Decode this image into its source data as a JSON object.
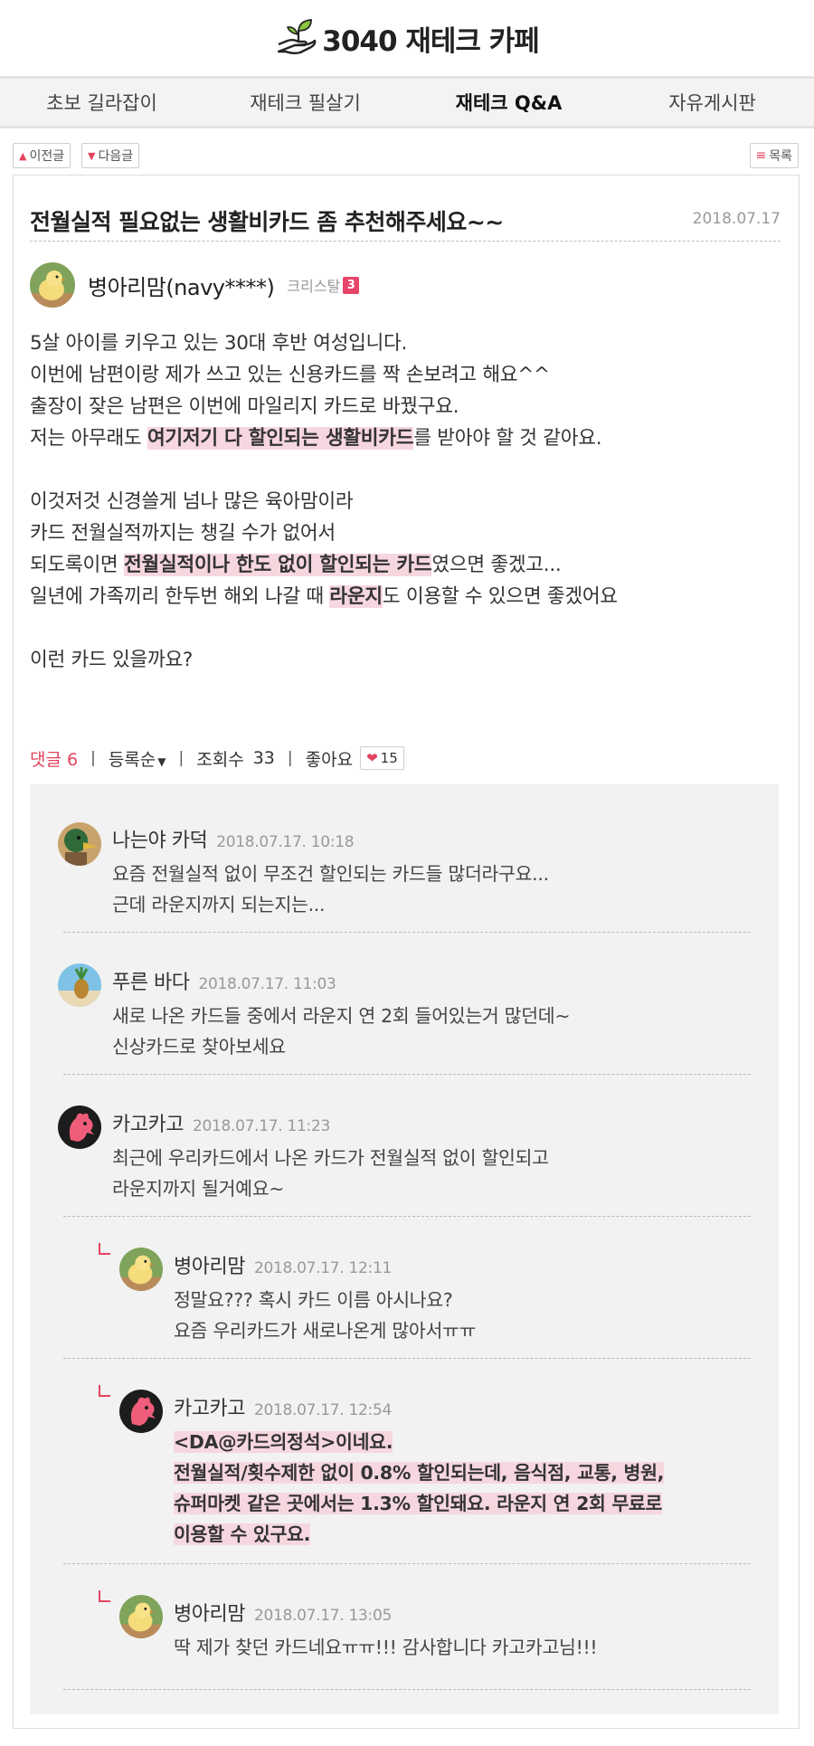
{
  "site": {
    "title": "3040 재테크 카페",
    "logo_icon": "hand-sprout-icon",
    "accent": "#e4445f"
  },
  "nav": {
    "items": [
      {
        "label": "초보 길라잡이"
      },
      {
        "label": "재테크 필살기"
      },
      {
        "label": "재테크 Q&A",
        "active": true
      },
      {
        "label": "자유게시판"
      }
    ]
  },
  "post_nav": {
    "prev": "이전글",
    "next": "다음글",
    "list": "목록"
  },
  "post": {
    "title": "전월실적 필요없는 생활비카드 좀 추천해주세요~~",
    "date": "2018.07.17",
    "author": "병아리맘(navy****)",
    "rank": "크리스탈",
    "rank_level": "3",
    "body": {
      "l1": "5살 아이를 키우고 있는 30대 후반 여성입니다.",
      "l2": "이번에 남편이랑 제가 쓰고 있는 신용카드를 짝 손보려고 해요^^",
      "l3": "출장이 잦은 남편은 이번에 마일리지 카드로 바꿨구요.",
      "l4a": "저는 아무래도 ",
      "l4b": "여기저기 다 할인되는 생활비카드",
      "l4c": "를 받아야 할 것 같아요.",
      "l5": "이것저것 신경쓸게 넘나 많은 육아맘이라",
      "l6": "카드 전월실적까지는 챙길 수가 없어서",
      "l7a": "되도록이면 ",
      "l7b": "전월실적이나 한도 없이 할인되는 카드",
      "l7c": "였으면 좋겠고...",
      "l8a": "일년에 가족끼리 한두번 해외 나갈 때 ",
      "l8b": "라운지",
      "l8c": "도 이용할 수 있으면 좋겠어요",
      "l9": "이런 카드 있을까요?"
    }
  },
  "stats": {
    "comments_label": "댓글 6",
    "sort_label": "등록순",
    "views_label": "조회수",
    "views": "33",
    "likes_label": "좋아요",
    "likes": "15"
  },
  "comments": [
    {
      "name": "나는야 카덕",
      "date": "2018.07.17.  10:18",
      "avatar": "duck-avatar",
      "lines": [
        "요즘 전월실적 없이 무조건 할인되는 카드들 많더라구요...",
        "근데 라운지까지 되는지는..."
      ]
    },
    {
      "name": "푸른 바다",
      "date": "2018.07.17.  11:03",
      "avatar": "pineapple-avatar",
      "lines": [
        "새로 나온 카드들 중에서 라운지 연 2회 들어있는거 많던데~",
        "신상카드로 찾아보세요"
      ]
    },
    {
      "name": "카고카고",
      "date": "2018.07.17.  11:23",
      "avatar": "rooster-avatar",
      "lines": [
        "최근에 우리카드에서 나온 카드가 전월실적 없이 할인되고",
        "라운지까지 될거예요~"
      ]
    },
    {
      "name": "병아리맘",
      "date": "2018.07.17.  12:11",
      "avatar": "chick-avatar",
      "reply": true,
      "lines": [
        "정말요??? 혹시 카드 이름 아시나요?",
        "요즘 우리카드가 새로나온게 많아서ㅠㅠ"
      ]
    },
    {
      "name": "카고카고",
      "date": "2018.07.17.  12:54",
      "avatar": "rooster-avatar",
      "reply": true,
      "lines": [
        "<DA@카드의정석>이네요.",
        "전월실적/횟수제한 없이 0.8% 할인되는데, 음식점, 교통, 병원,",
        "슈퍼마켓 같은 곳에서는 1.3% 할인돼요. 라운지 연 2회 무료로",
        "이용할 수 있구요."
      ]
    },
    {
      "name": "병아리맘",
      "date": "2018.07.17.  13:05",
      "avatar": "chick-avatar",
      "reply": true,
      "lines": [
        "딱 제가 찾던 카드네요ㅠㅠ!!! 감사합니다 카고카고님!!!"
      ]
    }
  ]
}
